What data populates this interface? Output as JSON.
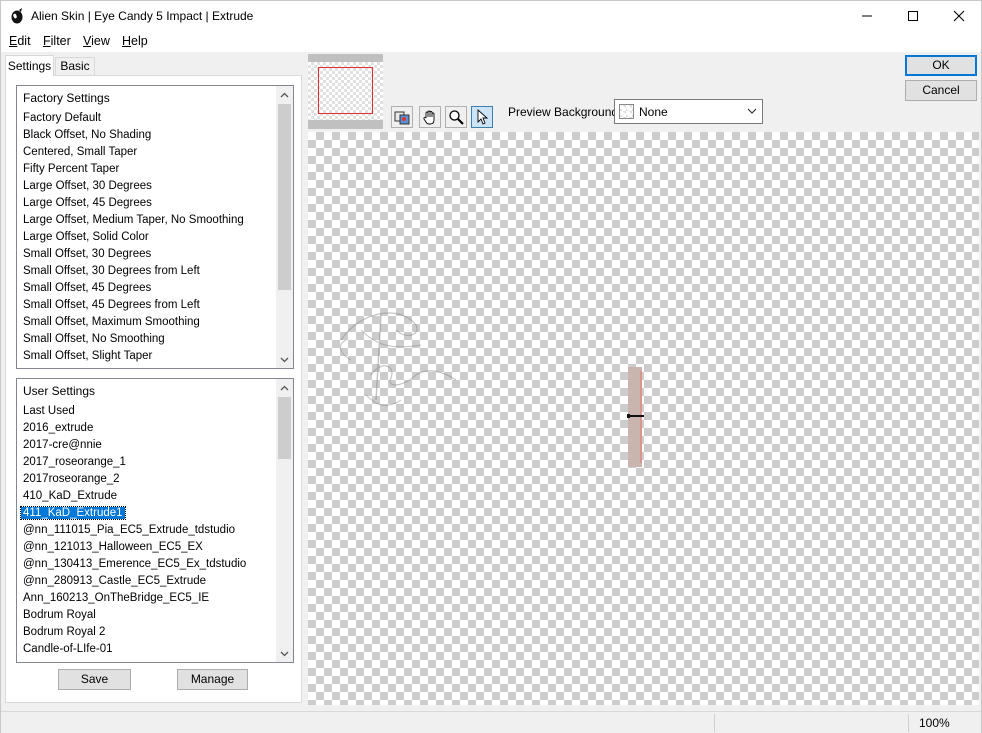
{
  "window": {
    "title": "Alien Skin | Eye Candy 5 Impact | Extrude"
  },
  "menu": [
    {
      "key": "E",
      "rest": "dit"
    },
    {
      "key": "F",
      "rest": "ilter"
    },
    {
      "key": "V",
      "rest": "iew"
    },
    {
      "key": "H",
      "rest": "elp"
    }
  ],
  "tabs": {
    "settings": "Settings",
    "basic": "Basic"
  },
  "factory": {
    "header": "Factory Settings",
    "items": [
      "Factory Default",
      "Black Offset, No Shading",
      "Centered, Small Taper",
      "Fifty Percent Taper",
      "Large Offset, 30 Degrees",
      "Large Offset, 45 Degrees",
      "Large Offset, Medium Taper, No Smoothing",
      "Large Offset, Solid Color",
      "Small Offset, 30 Degrees",
      "Small Offset, 30 Degrees from Left",
      "Small Offset, 45 Degrees",
      "Small Offset, 45 Degrees from Left",
      "Small Offset, Maximum Smoothing",
      "Small Offset, No Smoothing",
      "Small Offset, Slight Taper"
    ]
  },
  "user": {
    "header": "User Settings",
    "selected": "411_KaD_Extrude1",
    "items": [
      "Last Used",
      "2016_extrude",
      "2017-cre@nnie",
      "2017_roseorange_1",
      "2017roseorange_2",
      "410_KaD_Extrude",
      "411_KaD_Extrude1",
      "@nn_111015_Pia_EC5_Extrude_tdstudio",
      "@nn_121013_Halloween_EC5_EX",
      "@nn_130413_Emerence_EC5_Ex_tdstudio",
      "@nn_280913_Castle_EC5_Extrude",
      "Ann_160213_OnTheBridge_EC5_IE",
      "Bodrum Royal",
      "Bodrum Royal 2",
      "Candle-of-LIfe-01"
    ]
  },
  "buttons": {
    "save": "Save",
    "manage": "Manage",
    "ok": "OK",
    "cancel": "Cancel"
  },
  "preview": {
    "background_label": "Preview Background:",
    "background_value": "None",
    "tools": [
      "preview-toggle-icon",
      "hand-icon",
      "zoom-icon",
      "arrow-pointer-icon"
    ],
    "active_tool": "arrow-pointer-icon"
  },
  "status": {
    "zoom": "100%"
  },
  "colors": {
    "selection": "#0078d7",
    "extrude_body": "#c9b5ad",
    "extrude_edge": "#d8968c"
  }
}
